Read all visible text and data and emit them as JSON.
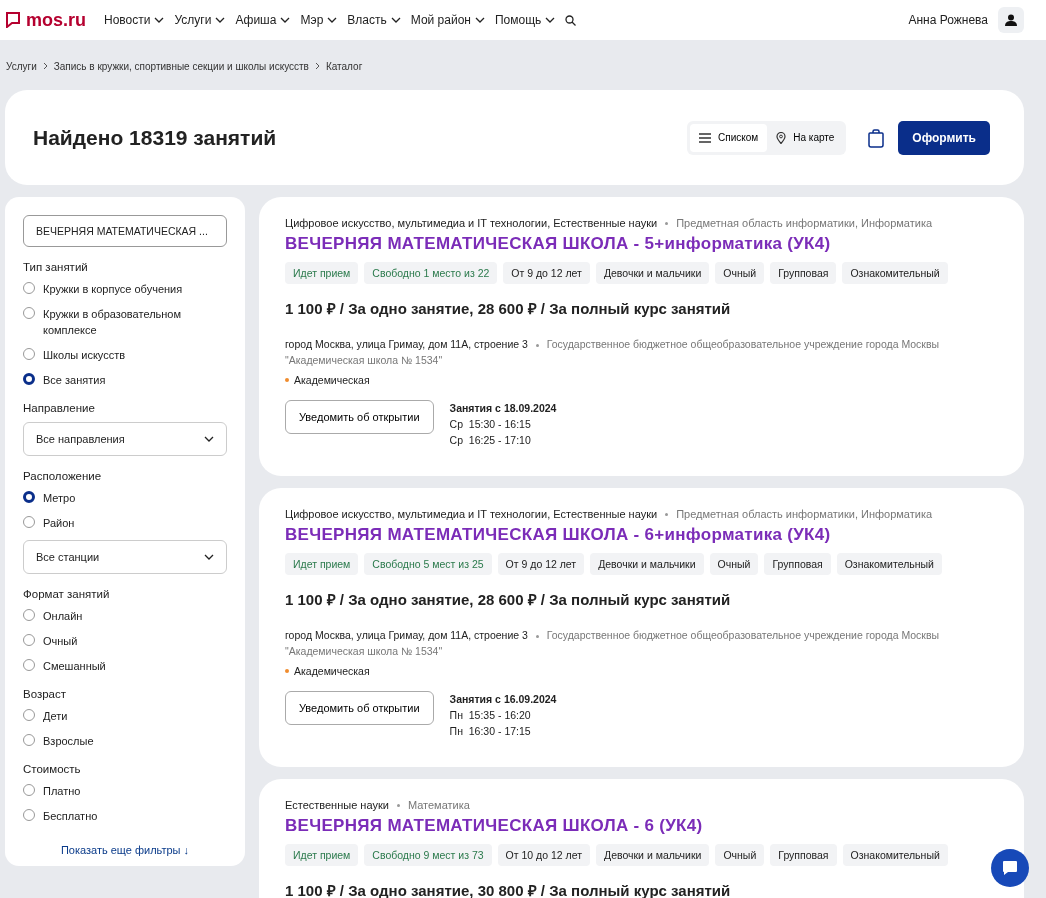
{
  "header": {
    "logo": "mos.ru",
    "nav": [
      {
        "label": "Новости"
      },
      {
        "label": "Услуги"
      },
      {
        "label": "Афиша"
      },
      {
        "label": "Мэр"
      },
      {
        "label": "Власть"
      },
      {
        "label": "Мой район"
      },
      {
        "label": "Помощь"
      }
    ],
    "user": "Анна Рожнева"
  },
  "breadcrumbs": [
    "Услуги",
    "Запись в кружки, спортивные секции и школы искусств",
    "Каталог"
  ],
  "results": {
    "title": "Найдено 18319 занятий",
    "views": [
      {
        "label": "Списком",
        "kind": "list",
        "selected": true
      },
      {
        "label": "На карте",
        "kind": "map",
        "selected": false
      }
    ],
    "submit": "Оформить"
  },
  "filters": {
    "search_value": "ВЕЧЕРНЯЯ МАТЕМАТИЧЕСКАЯ ...",
    "groups": [
      {
        "title": "Тип занятий",
        "items": [
          {
            "kind": "radio",
            "label": "Кружки в корпусе обучения",
            "selected": false
          },
          {
            "kind": "radio",
            "label": "Кружки в образовательном комплексе",
            "selected": false
          },
          {
            "kind": "radio",
            "label": "Школы искусств",
            "selected": false
          },
          {
            "kind": "radio",
            "label": "Все занятия",
            "selected": true
          }
        ]
      },
      {
        "title": "Направление",
        "items": [
          {
            "kind": "select",
            "label": "Все направления"
          }
        ]
      },
      {
        "title": "Расположение",
        "items": [
          {
            "kind": "radio",
            "label": "Метро",
            "selected": true
          },
          {
            "kind": "radio",
            "label": "Район",
            "selected": false
          },
          {
            "kind": "select",
            "label": "Все станции"
          }
        ]
      },
      {
        "title": "Формат занятий",
        "items": [
          {
            "kind": "radio",
            "label": "Онлайн",
            "selected": false
          },
          {
            "kind": "radio",
            "label": "Очный",
            "selected": false
          },
          {
            "kind": "radio",
            "label": "Смешанный",
            "selected": false
          }
        ]
      },
      {
        "title": "Возраст",
        "items": [
          {
            "kind": "radio",
            "label": "Дети",
            "selected": false
          },
          {
            "kind": "radio",
            "label": "Взрослые",
            "selected": false
          }
        ]
      },
      {
        "title": "Стоимость",
        "items": [
          {
            "kind": "radio",
            "label": "Платно",
            "selected": false
          },
          {
            "kind": "radio",
            "label": "Бесплатно",
            "selected": false
          }
        ]
      }
    ],
    "more": "Показать еще фильтры ↓"
  },
  "cards": [
    {
      "category": "Цифровое искусство, мультимедиа и IT технологии, Естественные науки",
      "subject": "Предметная область информатики, Информатика",
      "title": "ВЕЧЕРНЯЯ МАТЕМАТИЧЕСКАЯ ШКОЛА - 5+информатика (УК4)",
      "tags": [
        {
          "label": "Идет прием",
          "kind": "status"
        },
        {
          "label": "Свободно 1 место из 22",
          "kind": "status"
        },
        {
          "label": "От 9 до 12 лет",
          "kind": "info"
        },
        {
          "label": "Девочки и мальчики",
          "kind": "info"
        },
        {
          "label": "Очный",
          "kind": "info"
        },
        {
          "label": "Групповая",
          "kind": "info"
        },
        {
          "label": "Ознакомительный",
          "kind": "info"
        }
      ],
      "price": "1 100 ₽ / За одно занятие, 28 600 ₽ / За полный курс занятий",
      "address": "город Москва, улица Гримау, дом 11А, строение 3",
      "organization": "Государственное бюджетное общеобразовательное учреждение города Москвы \"Академическая школа № 1534\"",
      "metro": "Академическая",
      "button": "Уведомить об открытии",
      "schedule_title": "Занятия с 18.09.2024",
      "schedule": [
        "Ср  15:30 - 16:15",
        "Ср  16:25 - 17:10"
      ]
    },
    {
      "category": "Цифровое искусство, мультимедиа и IT технологии, Естественные науки",
      "subject": "Предметная область информатики, Информатика",
      "title": "ВЕЧЕРНЯЯ МАТЕМАТИЧЕСКАЯ ШКОЛА - 6+информатика (УК4)",
      "tags": [
        {
          "label": "Идет прием",
          "kind": "status"
        },
        {
          "label": "Свободно 5 мест из 25",
          "kind": "status"
        },
        {
          "label": "От 9 до 12 лет",
          "kind": "info"
        },
        {
          "label": "Девочки и мальчики",
          "kind": "info"
        },
        {
          "label": "Очный",
          "kind": "info"
        },
        {
          "label": "Групповая",
          "kind": "info"
        },
        {
          "label": "Ознакомительный",
          "kind": "info"
        }
      ],
      "price": "1 100 ₽ / За одно занятие, 28 600 ₽ / За полный курс занятий",
      "address": "город Москва, улица Гримау, дом 11А, строение 3",
      "organization": "Государственное бюджетное общеобразовательное учреждение города Москвы \"Академическая школа № 1534\"",
      "metro": "Академическая",
      "button": "Уведомить об открытии",
      "schedule_title": "Занятия с 16.09.2024",
      "schedule": [
        "Пн  15:35 - 16:20",
        "Пн  16:30 - 17:15"
      ]
    },
    {
      "category": "Естественные науки",
      "subject": "Математика",
      "title": "ВЕЧЕРНЯЯ МАТЕМАТИЧЕСКАЯ ШКОЛА - 6 (УК4)",
      "tags": [
        {
          "label": "Идет прием",
          "kind": "status"
        },
        {
          "label": "Свободно 9 мест из 73",
          "kind": "status"
        },
        {
          "label": "От 10 до 12 лет",
          "kind": "info"
        },
        {
          "label": "Девочки и мальчики",
          "kind": "info"
        },
        {
          "label": "Очный",
          "kind": "info"
        },
        {
          "label": "Групповая",
          "kind": "info"
        },
        {
          "label": "Ознакомительный",
          "kind": "info"
        }
      ],
      "price": "1 100 ₽ / За одно занятие, 30 800 ₽ / За полный курс занятий"
    }
  ]
}
